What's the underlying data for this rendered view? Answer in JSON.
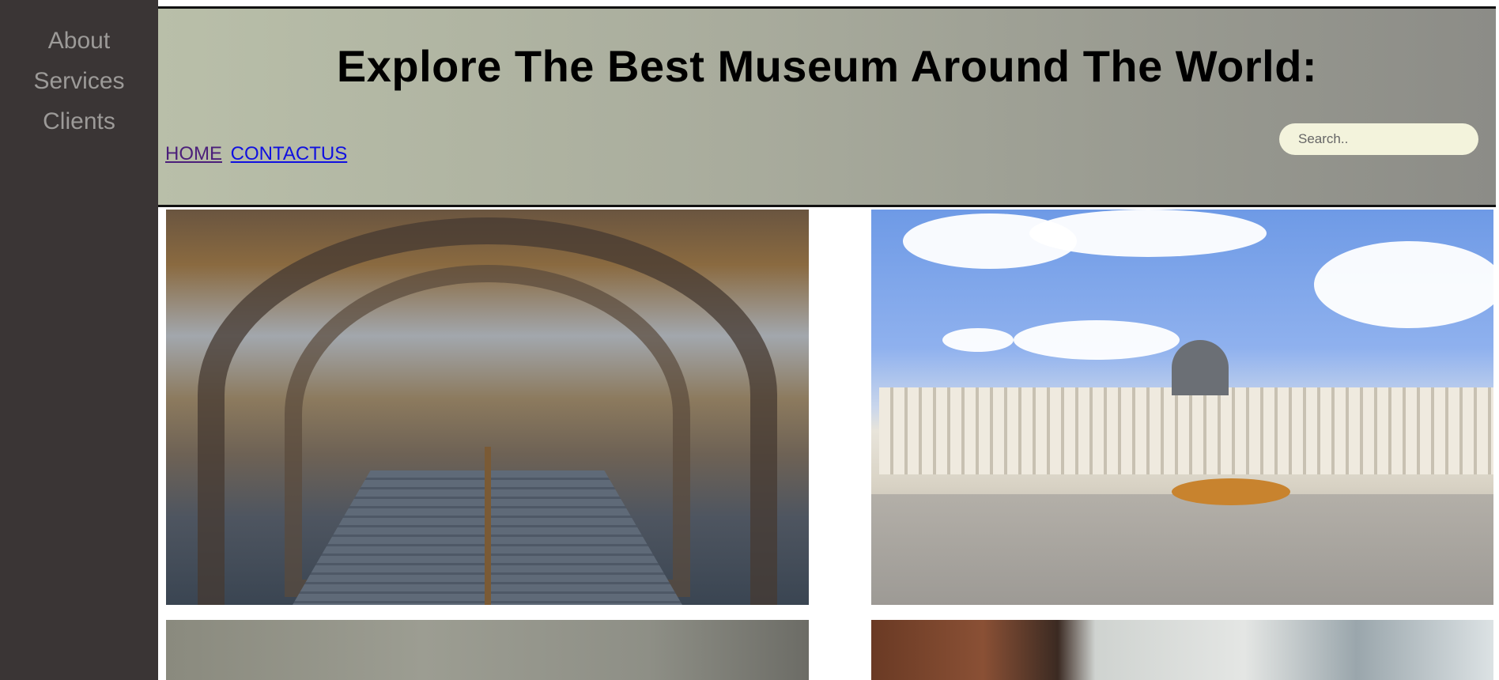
{
  "sidebar": {
    "items": [
      {
        "label": "About"
      },
      {
        "label": "Services"
      },
      {
        "label": "Clients"
      }
    ]
  },
  "header": {
    "title": "Explore The Best Museum Around The World:",
    "nav": [
      {
        "label": "HOME"
      },
      {
        "label": "CONTACTUS"
      }
    ],
    "search": {
      "placeholder": "Search.."
    }
  },
  "colors": {
    "sidebar_bg": "#3a3535",
    "sidebar_text": "#9c9a98",
    "search_bg": "#f3f3dc",
    "visited_link": "#4b1f7a",
    "link": "#1010e0"
  }
}
